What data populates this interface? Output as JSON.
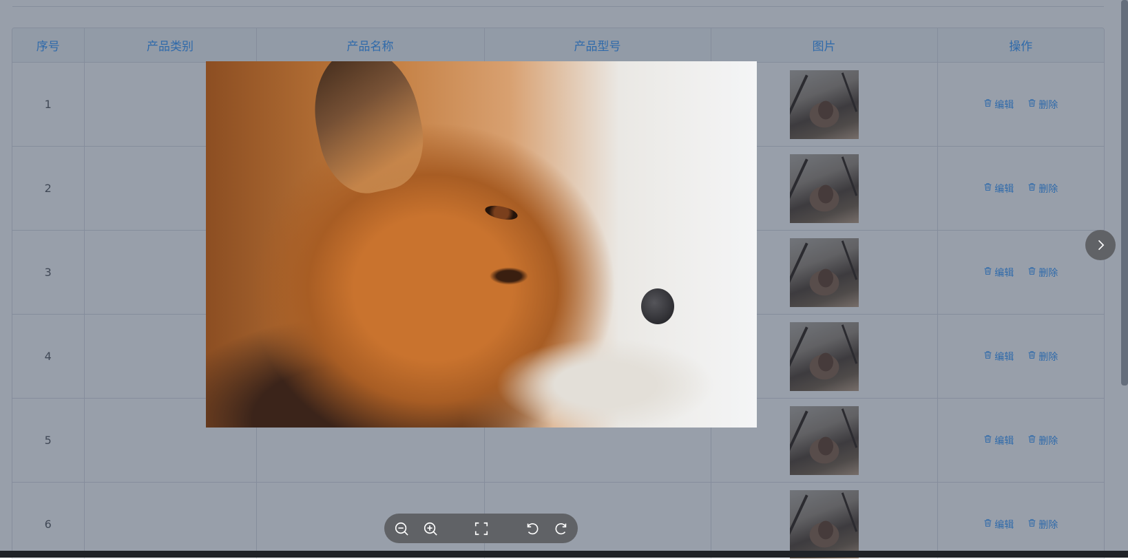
{
  "table": {
    "headers": [
      "序号",
      "产品类别",
      "产品名称",
      "产品型号",
      "图片",
      "操作"
    ],
    "rows": [
      {
        "index": "1",
        "category": "",
        "name": "",
        "model": ""
      },
      {
        "index": "2",
        "category": "",
        "name": "",
        "model": ""
      },
      {
        "index": "3",
        "category": "",
        "name": "",
        "model": ""
      },
      {
        "index": "4",
        "category": "",
        "name": "",
        "model": ""
      },
      {
        "index": "5",
        "category": "",
        "name": "",
        "model": ""
      },
      {
        "index": "6",
        "category": "",
        "name": "",
        "model": ""
      }
    ],
    "edit_label": "编辑",
    "delete_label": "删除"
  },
  "viewer": {
    "toolbar_icons": [
      "zoom-out-icon",
      "zoom-in-icon",
      "fullscreen-icon",
      "rotate-left-icon",
      "rotate-right-icon"
    ],
    "next_icon": "chevron-right-icon"
  },
  "colors": {
    "accent": "#409eff",
    "mask": "rgba(26,43,66,0.45)",
    "toolbar_bg": "#606266"
  }
}
